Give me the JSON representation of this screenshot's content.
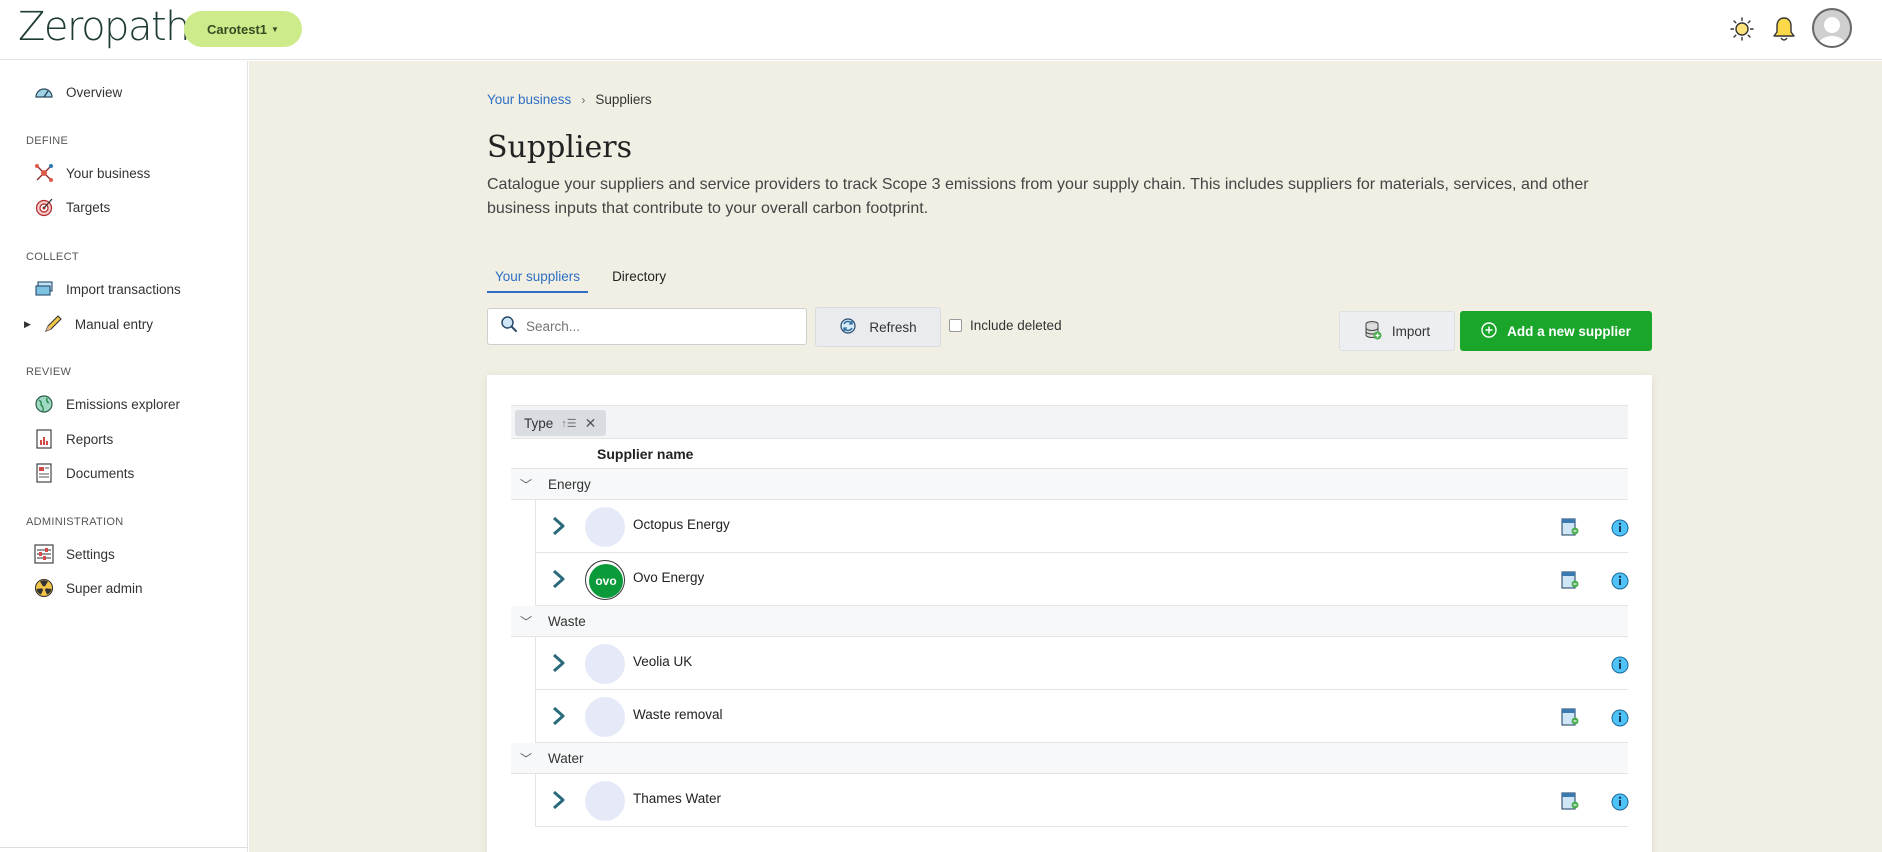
{
  "app": {
    "logo_text": "Zeropath",
    "org_name": "Carotest1"
  },
  "topbar": {
    "icons": [
      "sun-icon",
      "bell-icon",
      "user-avatar-icon"
    ]
  },
  "sidebar": {
    "overview": "Overview",
    "sections": {
      "define": "DEFINE",
      "collect": "COLLECT",
      "review": "REVIEW",
      "administration": "ADMINISTRATION"
    },
    "items": {
      "your_business": "Your business",
      "targets": "Targets",
      "import_transactions": "Import transactions",
      "manual_entry": "Manual entry",
      "emissions_explorer": "Emissions explorer",
      "reports": "Reports",
      "documents": "Documents",
      "settings": "Settings",
      "super_admin": "Super admin"
    }
  },
  "breadcrumb": {
    "parent": "Your business",
    "current": "Suppliers"
  },
  "page": {
    "title": "Suppliers",
    "description": "Catalogue your suppliers and service providers to track Scope 3 emissions from your supply chain. This includes suppliers for materials, services, and other business inputs that contribute to your overall carbon footprint."
  },
  "tabs": {
    "your_suppliers": "Your suppliers",
    "directory": "Directory",
    "active": "Your suppliers"
  },
  "toolbar": {
    "search_placeholder": "Search...",
    "refresh_label": "Refresh",
    "include_deleted_label": "Include deleted",
    "include_deleted_checked": false,
    "import_label": "Import",
    "add_supplier_label": "Add a new supplier"
  },
  "table": {
    "group_chip": "Type",
    "column_supplier_name": "Supplier name",
    "groups": [
      {
        "name": "Energy",
        "rows": [
          {
            "name": "Octopus Energy",
            "has_doc": true
          },
          {
            "name": "Ovo Energy",
            "has_doc": true
          }
        ]
      },
      {
        "name": "Waste",
        "rows": [
          {
            "name": "Veolia UK",
            "has_doc": false
          },
          {
            "name": "Waste removal",
            "has_doc": true
          }
        ]
      },
      {
        "name": "Water",
        "rows": [
          {
            "name": "Thames Water",
            "has_doc": true
          }
        ]
      }
    ]
  },
  "colors": {
    "accent_blue": "#2d6fc4",
    "primary_green": "#1aa52b",
    "org_pill": "#cdeb8b",
    "main_bg": "#f1efe3"
  }
}
